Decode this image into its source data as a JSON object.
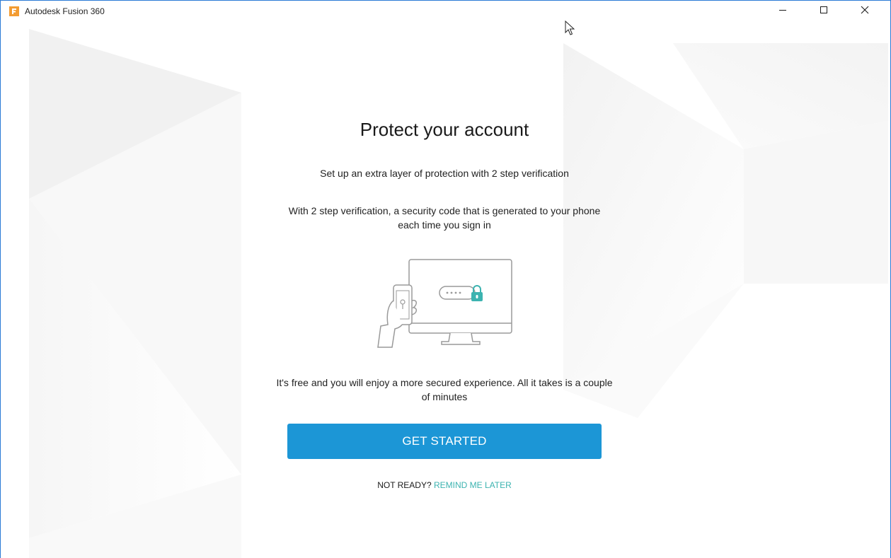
{
  "window": {
    "title": "Autodesk Fusion 360",
    "icon": "fusion-app-icon",
    "controls": [
      "minimize-icon",
      "maximize-icon",
      "close-icon"
    ]
  },
  "main": {
    "heading": "Protect your account",
    "subtitle": "Set up an extra layer of protection with 2 step verification",
    "description": "With 2 step verification, a security code that is generated to your phone each time you sign in",
    "illustration_icons": [
      "phone-icon",
      "monitor-icon",
      "password-lock-icon"
    ],
    "note": "It's free and you will enjoy a more secured experience. All it takes is a couple of minutes",
    "cta_label": "GET STARTED",
    "not_ready_prefix": "NOT READY?",
    "remind_later_label": "REMIND ME LATER"
  },
  "colors": {
    "accent": "#1c96d6",
    "link": "#3cb3b0",
    "lock": "#3cb3b0",
    "window_border": "#2b7bd6",
    "app_icon": "#f39c32"
  }
}
